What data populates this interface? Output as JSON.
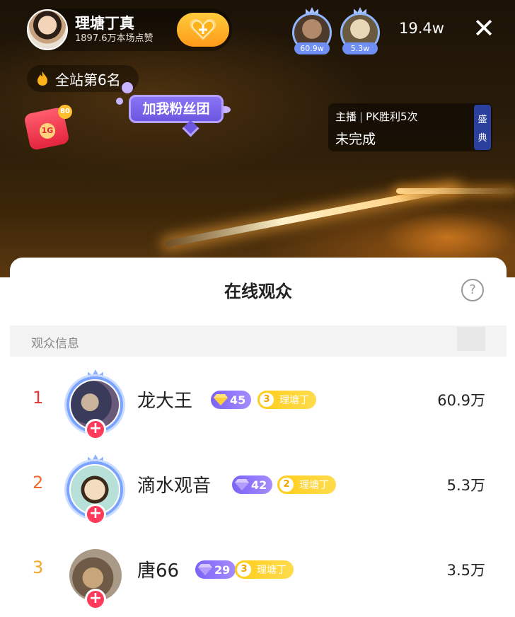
{
  "host": {
    "name": "理塘丁真",
    "likes": "1897.6万本场点赞"
  },
  "top_viewers": [
    {
      "tag": "60.9w"
    },
    {
      "tag": "5.3w"
    }
  ],
  "online_count": "19.4w",
  "rank": "全站第6名",
  "red_envelope": {
    "seal": "1G",
    "badge": "80"
  },
  "fan_bubble": "加我粉丝团",
  "pk": {
    "role": "主播",
    "task": "PK胜利5次",
    "status": "未完成",
    "side_chars": [
      "盛",
      "典"
    ]
  },
  "sheet": {
    "title": "在线观众",
    "help": "?",
    "section_label": "观众信息"
  },
  "viewers": [
    {
      "rank": "1",
      "name": "龙大王",
      "level": "45",
      "fan_level": "3",
      "fan_label": "理塘丁",
      "score": "60.9万"
    },
    {
      "rank": "2",
      "name": "滴水观音",
      "level": "42",
      "fan_level": "2",
      "fan_label": "理塘丁",
      "score": "5.3万"
    },
    {
      "rank": "3",
      "name": "唐66",
      "level": "29",
      "fan_level": "3",
      "fan_label": "理塘丁",
      "score": "3.5万"
    }
  ],
  "colors": {
    "rank1": "#e83a3a",
    "rank2": "#f06a2a",
    "rank3": "#f5a623",
    "level_badge": "#7b63f5",
    "fan_badge": "#ffcc1a",
    "plus": "#ff3b5c"
  }
}
